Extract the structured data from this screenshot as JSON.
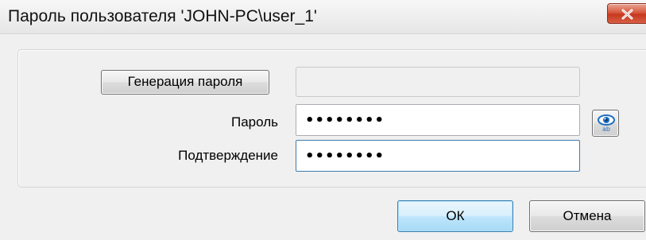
{
  "window": {
    "title": "Пароль пользователя 'JOHN-PC\\user_1'"
  },
  "form": {
    "generate_button_label": "Генерация пароля",
    "generated_value": "",
    "password_label": "Пароль",
    "password_value": "12345678",
    "confirm_label": "Подтверждение",
    "confirm_value": "12345678",
    "show_password_icon": "eye-icon"
  },
  "footer": {
    "ok_label": "ОК",
    "cancel_label": "Отмена"
  },
  "colors": {
    "close_button": "#c5381f",
    "ok_button_border": "#3c7fb1",
    "eye_icon": "#1f6fc0"
  }
}
